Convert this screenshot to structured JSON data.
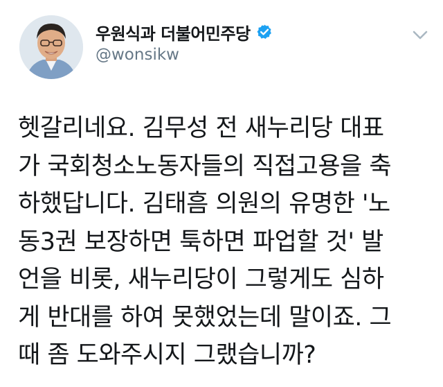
{
  "author": {
    "display_name": "우원식과 더불어민주당",
    "handle": "@wonsikw",
    "verified": true
  },
  "tweet": {
    "lines": [
      "헷갈리네요. 김무성 전 새누리당 대표",
      "가 국회청소노동자들의 직접고용을 축",
      "하했답니다. 김태흠 의원의 유명한 '노",
      "동3권 보장하면 툭하면 파업할 것' 발",
      "언을 비롯, 새누리당이 그렇게도 심하",
      "게 반대를 하여 못했었는데 말이죠. 그",
      "때 좀 도와주시지 그랬습니까?"
    ]
  },
  "icons": {
    "avatar": "profile-photo",
    "verified": "verified-badge-icon",
    "menu": "chevron-down-icon"
  },
  "colors": {
    "verified_blue": "#1da1f2",
    "handle_gray": "#657786",
    "text": "#14171a",
    "caret_gray": "#aab8c2"
  }
}
